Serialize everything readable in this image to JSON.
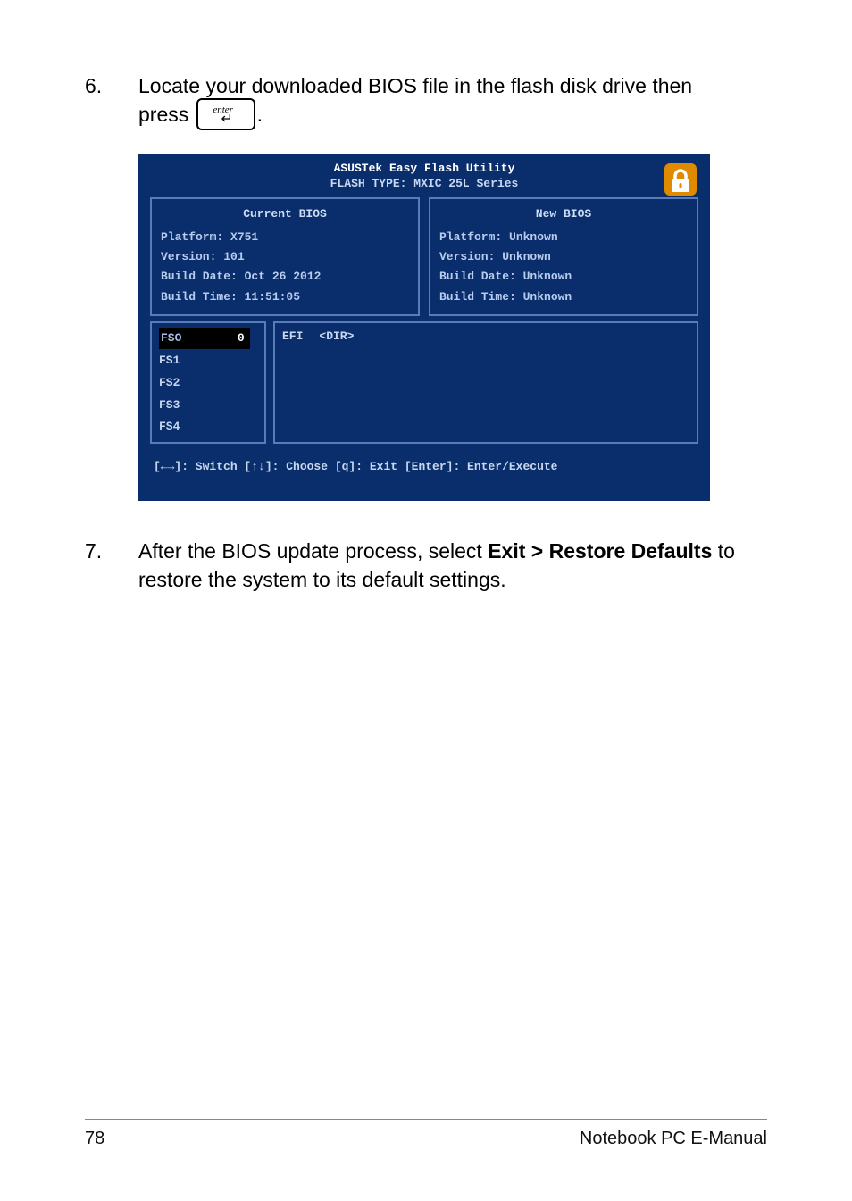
{
  "steps": {
    "s6": {
      "num": "6.",
      "text_a": "Locate your downloaded BIOS file in the flash disk drive then",
      "text_b": "press ",
      "text_c": "."
    },
    "s7": {
      "num": "7.",
      "text_a": "After the BIOS update process, select ",
      "bold": "Exit > Restore Defaults",
      "text_b": " to restore the system to its default settings."
    }
  },
  "key": {
    "label": "enter",
    "arrow": "↵"
  },
  "bios": {
    "title": "ASUSTek Easy Flash Utility",
    "subtitle": "FLASH TYPE: MXIC 25L Series",
    "current": {
      "header": "Current BIOS",
      "platform": "Platform: X751",
      "version": "Version: 101",
      "build_date": "Build Date: Oct 26 2012",
      "build_time": "Build Time: 11:51:05"
    },
    "new": {
      "header": "New BIOS",
      "platform": "Platform: Unknown",
      "version": "Version: Unknown",
      "build_date": "Build Date: Unknown",
      "build_time": "Build Time: Unknown"
    },
    "fs": {
      "sel_label": "FSO",
      "sel_val": "0",
      "items": [
        "FS1",
        "FS2",
        "FS3",
        "FS4"
      ]
    },
    "files": {
      "row1a": "EFI",
      "row1b": "<DIR>"
    },
    "help": "[←→]: Switch [↑↓]: Choose [q]: Exit [Enter]: Enter/Execute"
  },
  "footer": {
    "page": "78",
    "title": "Notebook PC E-Manual"
  }
}
